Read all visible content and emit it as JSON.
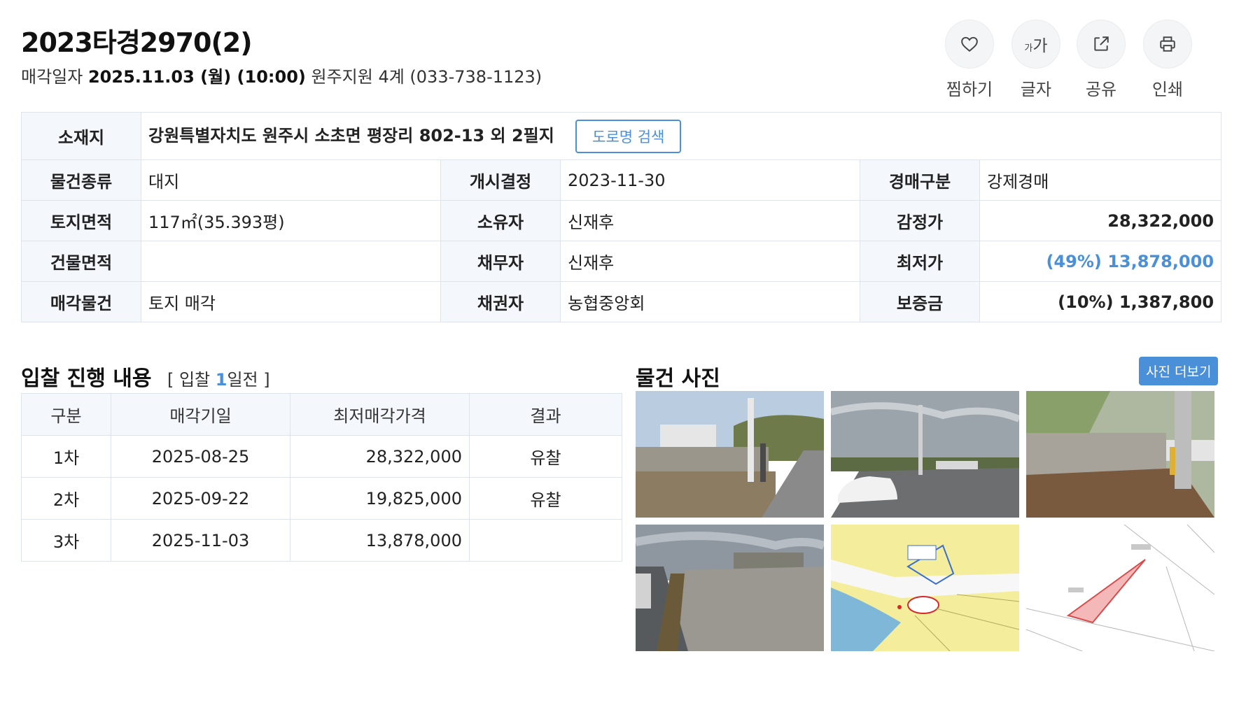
{
  "header": {
    "case_no": "2023타경2970(2)",
    "sale_date_label": "매각일자",
    "sale_date": "2025.11.03 (월) (10:00)",
    "court": "원주지원 4계 (033-738-1123)"
  },
  "actions": [
    {
      "label": "찜하기",
      "icon": "heart-icon"
    },
    {
      "label": "글자",
      "icon": "font-size-icon",
      "glyph_small": "가",
      "glyph_large": "가"
    },
    {
      "label": "공유",
      "icon": "share-icon"
    },
    {
      "label": "인쇄",
      "icon": "print-icon"
    }
  ],
  "info": {
    "location_label": "소재지",
    "location": "강원특별자치도 원주시 소초면 평장리 802-13 외 2필지",
    "road_search_label": "도로명 검색",
    "rows": [
      {
        "l1": "물건종류",
        "v1": "대지",
        "l2": "개시결정",
        "v2": "2023-11-30",
        "l3": "경매구분",
        "v3": "강제경매"
      },
      {
        "l1": "토지면적",
        "v1": "117㎡(35.393평)",
        "l2": "소유자",
        "v2": "신재후",
        "l3": "감정가",
        "v3": "28,322,000"
      },
      {
        "l1": "건물면적",
        "v1": "",
        "l2": "채무자",
        "v2": "신재후",
        "l3": "최저가",
        "v3": "(49%) 13,878,000"
      },
      {
        "l1": "매각물건",
        "v1": "토지 매각",
        "l2": "채권자",
        "v2": "농협중앙회",
        "l3": "보증금",
        "v3": "(10%) 1,387,800"
      }
    ]
  },
  "bid": {
    "title": "입찰 진행 내용",
    "sub_prefix": "[ 입찰",
    "sub_days": "1",
    "sub_suffix": "일전 ]",
    "headers": [
      "구분",
      "매각기일",
      "최저매각가격",
      "결과"
    ],
    "rows": [
      {
        "round": "1차",
        "date": "2025-08-25",
        "price": "28,322,000",
        "result": "유찰"
      },
      {
        "round": "2차",
        "date": "2025-09-22",
        "price": "19,825,000",
        "result": "유찰"
      },
      {
        "round": "3차",
        "date": "2025-11-03",
        "price": "13,878,000",
        "result": ""
      }
    ]
  },
  "photos": {
    "title": "물건 사진",
    "more_label": "사진 더보기"
  },
  "colors": {
    "accent": "#4a90d9",
    "header_bg": "#f4f7fb",
    "border": "#dfe3ea"
  }
}
